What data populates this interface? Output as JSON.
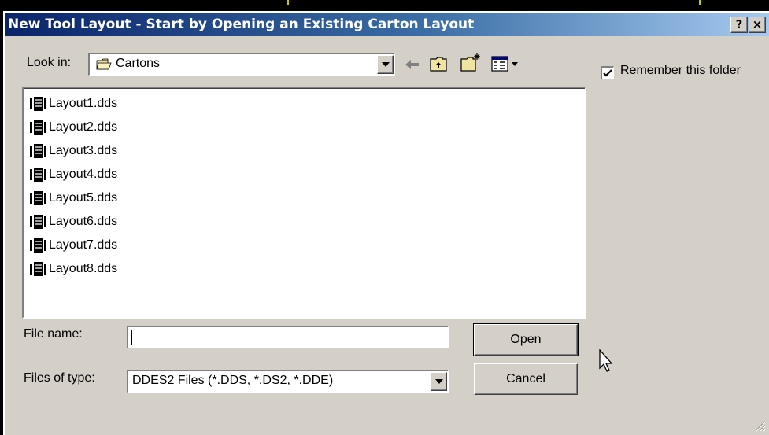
{
  "window": {
    "title": "New Tool Layout - Start by Opening an Existing Carton Layout",
    "help_label": "?",
    "close_label": "×"
  },
  "look_in": {
    "label": "Look in:",
    "value": "Cartons",
    "icons": [
      "folder-icon",
      "back-arrow-icon",
      "up-folder-icon",
      "new-folder-icon",
      "view-menu-icon"
    ]
  },
  "remember": {
    "label": "Remember this folder",
    "checked": true
  },
  "files": [
    {
      "name": "Layout1.dds"
    },
    {
      "name": "Layout2.dds"
    },
    {
      "name": "Layout3.dds"
    },
    {
      "name": "Layout4.dds"
    },
    {
      "name": "Layout5.dds"
    },
    {
      "name": "Layout6.dds"
    },
    {
      "name": "Layout7.dds"
    },
    {
      "name": "Layout8.dds"
    }
  ],
  "file_name": {
    "label": "File name:",
    "value": ""
  },
  "file_type": {
    "label": "Files of type:",
    "value": "DDES2 Files (*.DDS, *.DS2, *.DDE)"
  },
  "buttons": {
    "open": "Open",
    "cancel": "Cancel"
  },
  "colors": {
    "titlebar_start": "#0a246a",
    "titlebar_end": "#a6caf0",
    "dialog_bg": "#d4d0c8"
  }
}
